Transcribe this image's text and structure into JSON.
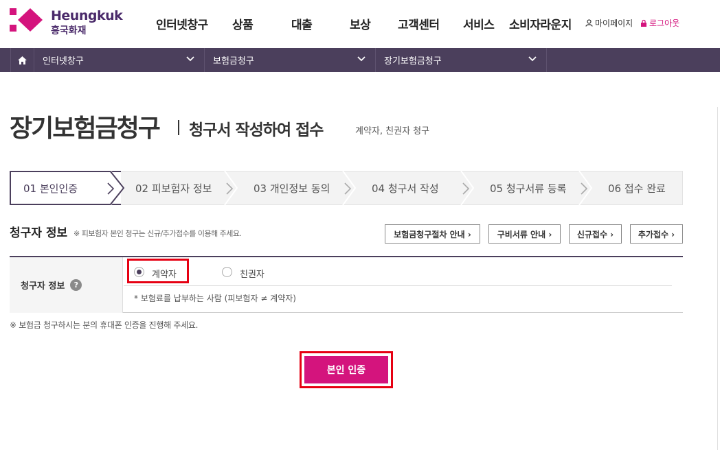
{
  "brand": {
    "name_en": "Heungkuk",
    "name_ko": "흥국화재",
    "color": "#d4147d"
  },
  "gnb": [
    "인터넷창구",
    "상품",
    "대출",
    "보상",
    "고객센터",
    "서비스",
    "소비자라운지"
  ],
  "util": {
    "mypage": "마이페이지",
    "logout": "로그아웃"
  },
  "location": {
    "home_icon": "home-icon",
    "items": [
      "인터넷창구",
      "보험금청구",
      "장기보험금청구"
    ]
  },
  "page": {
    "title": "장기보험금청구",
    "subtitle": "청구서 작성하여 접수",
    "desc": "계약자, 친권자 청구"
  },
  "steps": [
    {
      "label": "01  본인인증",
      "active": true
    },
    {
      "label": "02  피보험자 정보"
    },
    {
      "label": "03  개인정보 동의"
    },
    {
      "label": "04  청구서 작성"
    },
    {
      "label": "05  청구서류 등록"
    },
    {
      "label": "06  접수 완료"
    }
  ],
  "claimant": {
    "title": "청구자 정보",
    "note": "※ 피보험자 본인 청구는 신규/추가접수를 이용해 주세요.",
    "buttons": [
      "보험금청구절차 안내 ›",
      "구비서류 안내 ›",
      "신규접수 ›",
      "추가접수 ›"
    ],
    "row_label": "청구자 정보",
    "help_icon": "question-icon",
    "options": [
      {
        "label": "계약자",
        "checked": true
      },
      {
        "label": "친권자",
        "checked": false
      }
    ],
    "option_note": "* 보험료를 납부하는 사람 (피보험자 ≠ 계약자)"
  },
  "bottom_note": "※ 보험금 청구하시는 분의 휴대폰 인증을 진행해 주세요.",
  "verify_button": "본인 인증",
  "colors": {
    "purple": "#4b3f5c",
    "pink": "#d4147d",
    "highlight": "#e60012"
  }
}
